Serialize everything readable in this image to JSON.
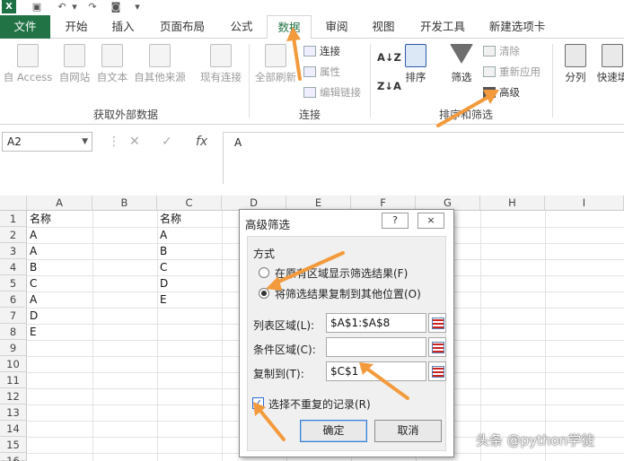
{
  "qat": {
    "app_icon": "X"
  },
  "tabs": [
    "文件",
    "开始",
    "插入",
    "页面布局",
    "公式",
    "数据",
    "审阅",
    "视图",
    "开发工具",
    "新建选项卡"
  ],
  "ribbon": {
    "external": {
      "access": "自 Access",
      "web": "自网站",
      "text": "自文本",
      "other": "自其他来源",
      "existing": "现有连接",
      "group": "获取外部数据"
    },
    "connections": {
      "refresh_all": "全部刷新",
      "connections": "连接",
      "properties": "属性",
      "edit_links": "编辑链接",
      "group": "连接"
    },
    "sort_filter": {
      "sort": "排序",
      "filter": "筛选",
      "clear": "清除",
      "reapply": "重新应用",
      "advanced": "高级",
      "group": "排序和筛选"
    },
    "tools": {
      "text_to_columns": "分列",
      "flash_fill": "快速填"
    }
  },
  "formula_bar": {
    "name_box": "A2",
    "formula": "A"
  },
  "grid": {
    "columns": [
      "A",
      "B",
      "C",
      "D",
      "E",
      "F",
      "G",
      "H",
      "I"
    ],
    "rows": [
      "1",
      "2",
      "3",
      "4",
      "5",
      "6",
      "7",
      "8",
      "9",
      "10",
      "11",
      "12",
      "13",
      "14",
      "15",
      "16"
    ],
    "colA": [
      "名称",
      "A",
      "A",
      "B",
      "C",
      "A",
      "D",
      "E"
    ],
    "colC": [
      "名称",
      "A",
      "B",
      "C",
      "D",
      "E"
    ]
  },
  "dialog": {
    "title": "高级筛选",
    "help_btn": "?",
    "close_btn": "×",
    "section_label": "方式",
    "radio1": "在原有区域显示筛选结果(F)",
    "radio2": "将筛选结果复制到其他位置(O)",
    "list_range_label": "列表区域(L):",
    "list_range_value": "$A$1:$A$8",
    "criteria_label": "条件区域(C):",
    "criteria_value": "",
    "copy_to_label": "复制到(T):",
    "copy_to_value": "$C$1",
    "unique_label": "选择不重复的记录(R)",
    "ok": "确定",
    "cancel": "取消"
  },
  "watermark": "头条 @python学徒",
  "colors": {
    "excel_green": "#217346",
    "annotation_orange": "#f39a3c"
  }
}
